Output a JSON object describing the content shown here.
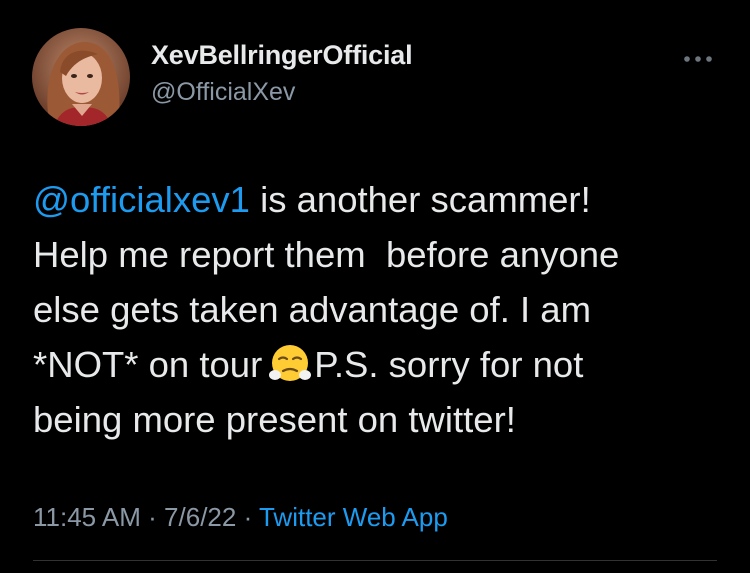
{
  "author": {
    "display_name": "XevBellringerOfficial",
    "handle": "@OfficialXev",
    "avatar_icon": "profile-photo"
  },
  "menu": {
    "icon": "more-horizontal-icon"
  },
  "tweet": {
    "mention": "@officialxev1",
    "line1_rest": " is another scammer!",
    "line2": "Help me report them  before anyone",
    "line3": "else gets taken advantage of. I am",
    "line4_before": "*NOT* on tour",
    "emoji_icon": "face-with-steam-from-nose-emoji",
    "line4_after": "P.S. sorry for not",
    "line5": "being more present on twitter!"
  },
  "meta": {
    "time": "11:45 AM",
    "sep1": " · ",
    "date": "7/6/22",
    "sep2": " · ",
    "source": "Twitter Web App"
  },
  "colors": {
    "background": "#000000",
    "text": "#e7e9ea",
    "secondary": "#8b98a5",
    "link": "#1d9bf0"
  }
}
